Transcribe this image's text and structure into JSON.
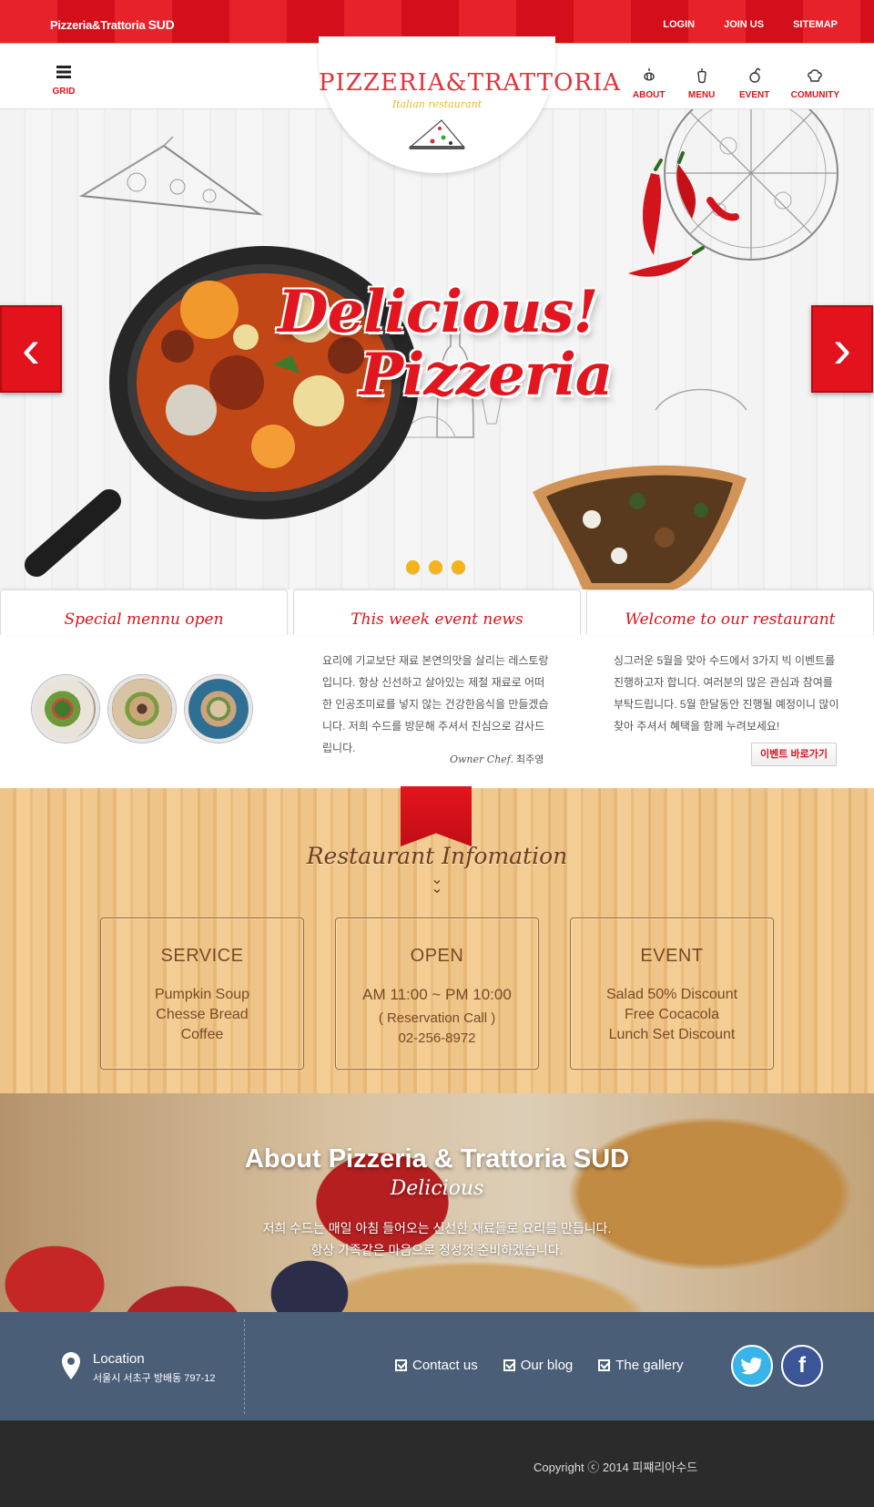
{
  "topbar": {
    "brand_prefix": "Pizzeria&Trattoria ",
    "brand_suffix": "SUD",
    "links": [
      "LOGIN",
      "JOIN US",
      "SITEMAP"
    ]
  },
  "header": {
    "grid_label": "GRID",
    "logo_title": "PIZZERIA&TRATTORIA",
    "logo_subtitle": "Italian restaurant",
    "nav": [
      {
        "label": "ABOUT",
        "icon": "garlic-icon"
      },
      {
        "label": "MENU",
        "icon": "pepper-icon"
      },
      {
        "label": "EVENT",
        "icon": "tomato-icon"
      },
      {
        "label": "COMUNITY",
        "icon": "chef-hat-icon"
      }
    ]
  },
  "hero": {
    "headline_1": "Delicious!",
    "headline_2": "Pizzeria",
    "prev_label": "‹",
    "next_label": "›",
    "slide_count": 3
  },
  "panels": {
    "special": {
      "title": "Special mennu open"
    },
    "news": {
      "title": "This week event news",
      "body": "요리에 기교보단 재료 본연의맛을 살리는 레스토랑입니다. 항상 신선하고 살아있는 제철 재료로 어떠한 인공조미료를 넣지 않는 건강한음식을 만들겠습니다. 저희 수드를 방문해 주셔서 진심으로 감사드립니다.",
      "sign_role": "Owner Chef.",
      "sign_name": "최주영"
    },
    "welcome": {
      "title": "Welcome to our restaurant",
      "body": "싱그러운 5월을 맞아 수드에서 3가지 빅 이벤트를 진행하고자 합니다. 여러분의 많은 관심과 참여를 부탁드립니다. 5월 한달동안 진행될 예정이니 많이 찾아 주셔서 혜택을 함께 누려보세요!",
      "button": "이벤트 바로가기"
    }
  },
  "info": {
    "title": "Restaurant Infomation",
    "boxes": [
      {
        "title": "SERVICE",
        "lines": [
          "Pumpkin Soup",
          "Chesse Bread",
          "Coffee"
        ]
      },
      {
        "title": "OPEN",
        "lines": [
          "AM 11:00 ~ PM 10:00",
          "( Reservation Call )",
          "02-256-8972"
        ]
      },
      {
        "title": "EVENT",
        "lines": [
          "Salad 50% Discount",
          "Free Cocacola",
          "Lunch Set Discount"
        ]
      }
    ]
  },
  "about": {
    "title": "About Pizzeria & Trattoria SUD",
    "subtitle": "Delicious",
    "line1": "저희 수드는 매일 아침 들어오는 신선한 재료들로 요리를 만듭니다.",
    "line2": "항상 가족같은 마음으로 정성껏 준비하겠습니다."
  },
  "infobar": {
    "location_title": "Location",
    "location_address": "서울시 서초구 방배동 797-12",
    "links": [
      "Contact us",
      "Our blog",
      "The gallery"
    ]
  },
  "footer": {
    "copyright": "Copyright ⓒ 2014 피쨰리아수드"
  },
  "colors": {
    "brand_red": "#e2131c",
    "accent_yellow": "#f4b31a",
    "infobar_blue": "#4a5e78"
  }
}
